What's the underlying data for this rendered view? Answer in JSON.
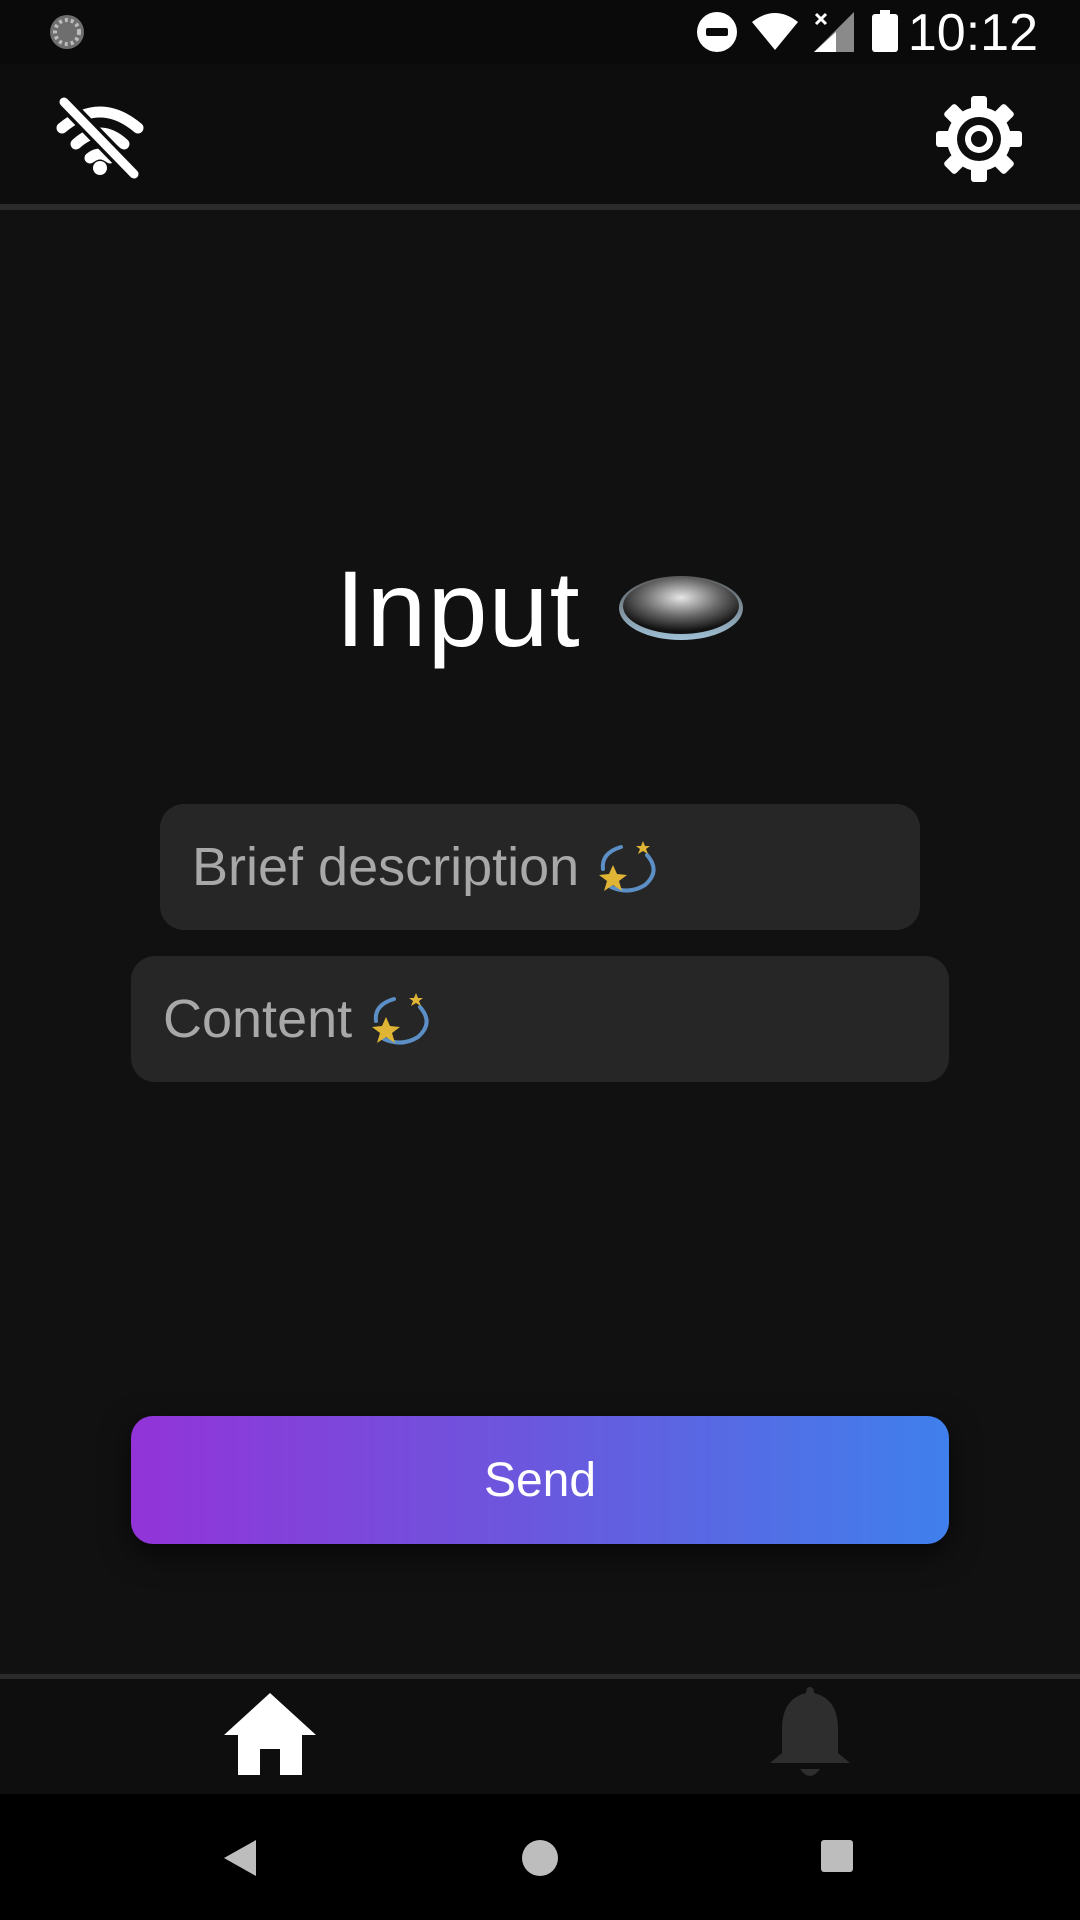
{
  "status_bar": {
    "time": "10:12",
    "icons": [
      "sync-icon",
      "do-not-disturb-icon",
      "wifi-icon",
      "cellular-no-signal-icon",
      "battery-icon"
    ]
  },
  "toolbar": {
    "left_icon": "wifi-off-icon",
    "right_icon": "gear-icon"
  },
  "title": {
    "text": "Input",
    "icon": "hole-icon"
  },
  "form": {
    "brief_placeholder": "Brief description",
    "content_placeholder": "Content",
    "field_icon": "dizzy-sparkle-icon"
  },
  "send_button": {
    "label": "Send",
    "gradient": [
      "#9234d8",
      "#3f80ec"
    ]
  },
  "bottom_nav": {
    "items": [
      {
        "name": "home",
        "icon": "home-icon",
        "active": true
      },
      {
        "name": "notifications",
        "icon": "bell-icon",
        "active": false
      }
    ]
  },
  "system_nav": {
    "buttons": [
      "back-icon",
      "home-circle-icon",
      "recents-icon"
    ]
  }
}
